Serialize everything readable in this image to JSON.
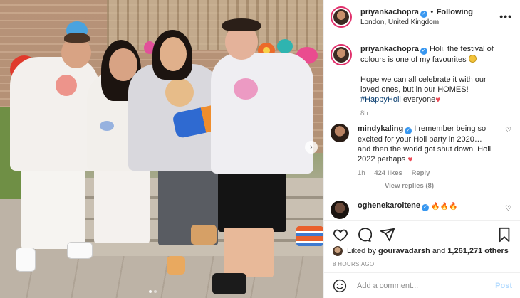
{
  "header": {
    "username": "priyankachopra",
    "separator": "•",
    "follow_status": "Following",
    "location": "London, United Kingdom",
    "more_icon": "more-horizontal-icon"
  },
  "caption": {
    "username": "priyankachopra",
    "text_1": "Holi, the festival of colours is one of my favourites",
    "text_2": "Hope we can all celebrate it with our loved ones, but in our HOMES!",
    "hashtag": "#HappyHoli",
    "text_3": "everyone",
    "time": "8h"
  },
  "comments": [
    {
      "username": "mindykaling",
      "text": "I remember being so excited for your Holi party in 2020… and then the world got shut down. Holi 2022 perhaps",
      "time": "1h",
      "likes": "424 likes",
      "reply": "Reply",
      "view_replies": "View replies (8)"
    },
    {
      "username": "oghenekaroitene",
      "text": ""
    }
  ],
  "actions": {
    "like_icon": "heart-icon",
    "comment_icon": "comment-icon",
    "share_icon": "send-icon",
    "save_icon": "bookmark-icon"
  },
  "likes": {
    "prefix": "Liked by",
    "user": "gouravadarsh",
    "conj": "and",
    "others": "1,261,271 others"
  },
  "timestamp": "8 HOURS AGO",
  "add_comment": {
    "placeholder": "Add a comment...",
    "post": "Post",
    "emoji_icon": "smiley-icon"
  },
  "colors": {
    "verified": "#3897f0",
    "hashtag": "#00376b",
    "heart": "#ed4956",
    "muted": "#8e8e8e",
    "post_disabled": "#b3dbff"
  }
}
